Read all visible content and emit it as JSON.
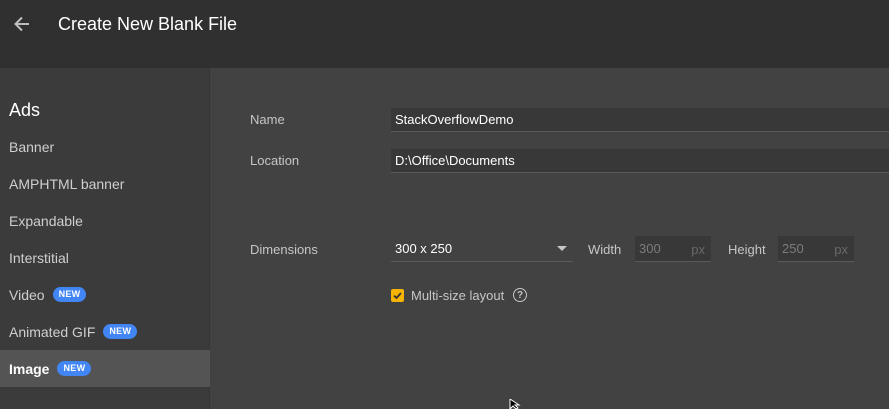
{
  "header": {
    "title": "Create New Blank File",
    "back_icon": "arrow-left-icon"
  },
  "sidebar": {
    "heading": "Ads",
    "items": [
      {
        "label": "Banner",
        "badge": ""
      },
      {
        "label": "AMPHTML banner",
        "badge": ""
      },
      {
        "label": "Expandable",
        "badge": ""
      },
      {
        "label": "Interstitial",
        "badge": ""
      },
      {
        "label": "Video",
        "badge": "NEW"
      },
      {
        "label": "Animated GIF",
        "badge": "NEW"
      },
      {
        "label": "Image",
        "badge": "NEW",
        "selected": true
      }
    ]
  },
  "form": {
    "name_label": "Name",
    "name_value": "StackOverflowDemo",
    "location_label": "Location",
    "location_value": "D:\\Office\\Documents",
    "dimensions_label": "Dimensions",
    "dimensions_value": "300 x 250",
    "width_label": "Width",
    "width_value": "300",
    "width_unit": "px",
    "height_label": "Height",
    "height_value": "250",
    "height_unit": "px",
    "multisize_label": "Multi-size layout",
    "multisize_checked": true,
    "help_glyph": "?"
  },
  "colors": {
    "header_bg": "#303030",
    "sidebar_bg": "#3b3b3b",
    "main_bg": "#424242",
    "badge_bg": "#4285f4",
    "checkbox_accent": "#f4b400"
  }
}
